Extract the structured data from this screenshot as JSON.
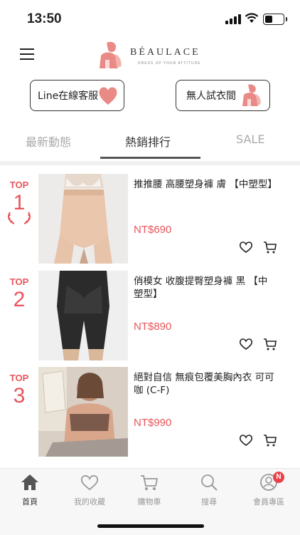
{
  "status_bar": {
    "time": "13:50"
  },
  "header": {
    "brand": "BÉAULACE",
    "tagline": "DRESS UP YOUR ATTITUDE"
  },
  "quick_buttons": {
    "line_service": "Line在線客服",
    "fitting_room": "無人試衣間"
  },
  "tabs": [
    {
      "label": "最新動態",
      "active": false
    },
    {
      "label": "熱銷排行",
      "active": true
    },
    {
      "label": "SALE",
      "active": false
    }
  ],
  "products": [
    {
      "rank_label": "TOP",
      "rank": "1",
      "title": "推推腰 高腰塑身褲 膚 【中塑型】",
      "price": "NT$690"
    },
    {
      "rank_label": "TOP",
      "rank": "2",
      "title": "俏模女 收腹提臀塑身褲 黑 【中塑型】",
      "price": "NT$890"
    },
    {
      "rank_label": "TOP",
      "rank": "3",
      "title": "絕對自信 無痕包覆美胸內衣 可可咖 (C-F)",
      "price": "NT$990"
    }
  ],
  "tab_bar": [
    {
      "label": "首頁",
      "icon": "home-icon",
      "active": true
    },
    {
      "label": "我的收藏",
      "icon": "heart-icon",
      "active": false
    },
    {
      "label": "購物車",
      "icon": "cart-icon",
      "active": false
    },
    {
      "label": "搜尋",
      "icon": "search-icon",
      "active": false
    },
    {
      "label": "會員專區",
      "icon": "user-icon",
      "active": false,
      "badge": "N"
    }
  ],
  "colors": {
    "accent": "#e8555b",
    "badge": "#e8434b",
    "logo": "#e98a86"
  }
}
